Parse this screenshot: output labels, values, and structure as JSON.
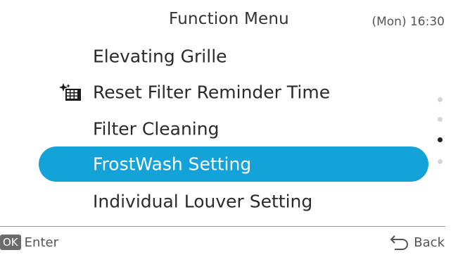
{
  "header": {
    "title": "Function Menu",
    "clock": "(Mon) 16:30"
  },
  "menu": {
    "items": [
      {
        "label": "Elevating Grille",
        "icon": null,
        "selected": false
      },
      {
        "label": "Reset Filter Reminder Time",
        "icon": "filter-sparkle-icon",
        "selected": false
      },
      {
        "label": "Filter Cleaning",
        "icon": null,
        "selected": false
      },
      {
        "label": "FrostWash Setting",
        "icon": null,
        "selected": true
      },
      {
        "label": "Individual Louver Setting",
        "icon": null,
        "selected": false
      }
    ]
  },
  "pager": {
    "total_pages": 4,
    "current_page": 3
  },
  "footer": {
    "ok_badge": "OK",
    "enter_label": "Enter",
    "back_label": "Back",
    "back_icon": "return-arrow-icon"
  },
  "colors": {
    "selection": "#13a3d8",
    "selected_text": "#ffffff",
    "text": "#2b2b2b",
    "dot_active": "#222222",
    "dot_inactive": "#d6d6d6",
    "ok_badge_bg": "#6b6b6b"
  }
}
